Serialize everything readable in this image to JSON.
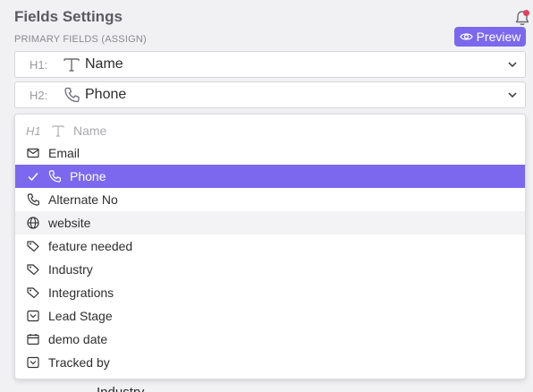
{
  "header": {
    "title": "Fields Settings",
    "section_label": "PRIMARY FIELDS (ASSIGN)",
    "preview_label": "Preview",
    "accent_color": "#7b68ee",
    "notification_dot_color": "#e5405e"
  },
  "fields": [
    {
      "slot": "H1:",
      "icon": "text-icon",
      "value": "Name"
    },
    {
      "slot": "H2:",
      "icon": "phone-icon",
      "value": "Phone"
    }
  ],
  "dropdown": {
    "header": {
      "slot": "H1",
      "icon": "text-icon",
      "label": "Name"
    },
    "items": [
      {
        "label": "Email",
        "icon": "mail-icon"
      },
      {
        "label": "Phone",
        "icon": "phone-icon",
        "selected": true
      },
      {
        "label": "Alternate No",
        "icon": "phone-icon"
      },
      {
        "label": "website",
        "icon": "globe-icon",
        "hovered": true
      },
      {
        "label": "feature needed",
        "icon": "tag-icon"
      },
      {
        "label": "Industry",
        "icon": "tag-icon"
      },
      {
        "label": "Integrations",
        "icon": "tag-icon"
      },
      {
        "label": "Lead Stage",
        "icon": "select-box-icon"
      },
      {
        "label": "demo date",
        "icon": "calendar-icon"
      },
      {
        "label": "Tracked by",
        "icon": "select-box-icon"
      }
    ]
  },
  "background": {
    "partial_label": "Industry"
  }
}
